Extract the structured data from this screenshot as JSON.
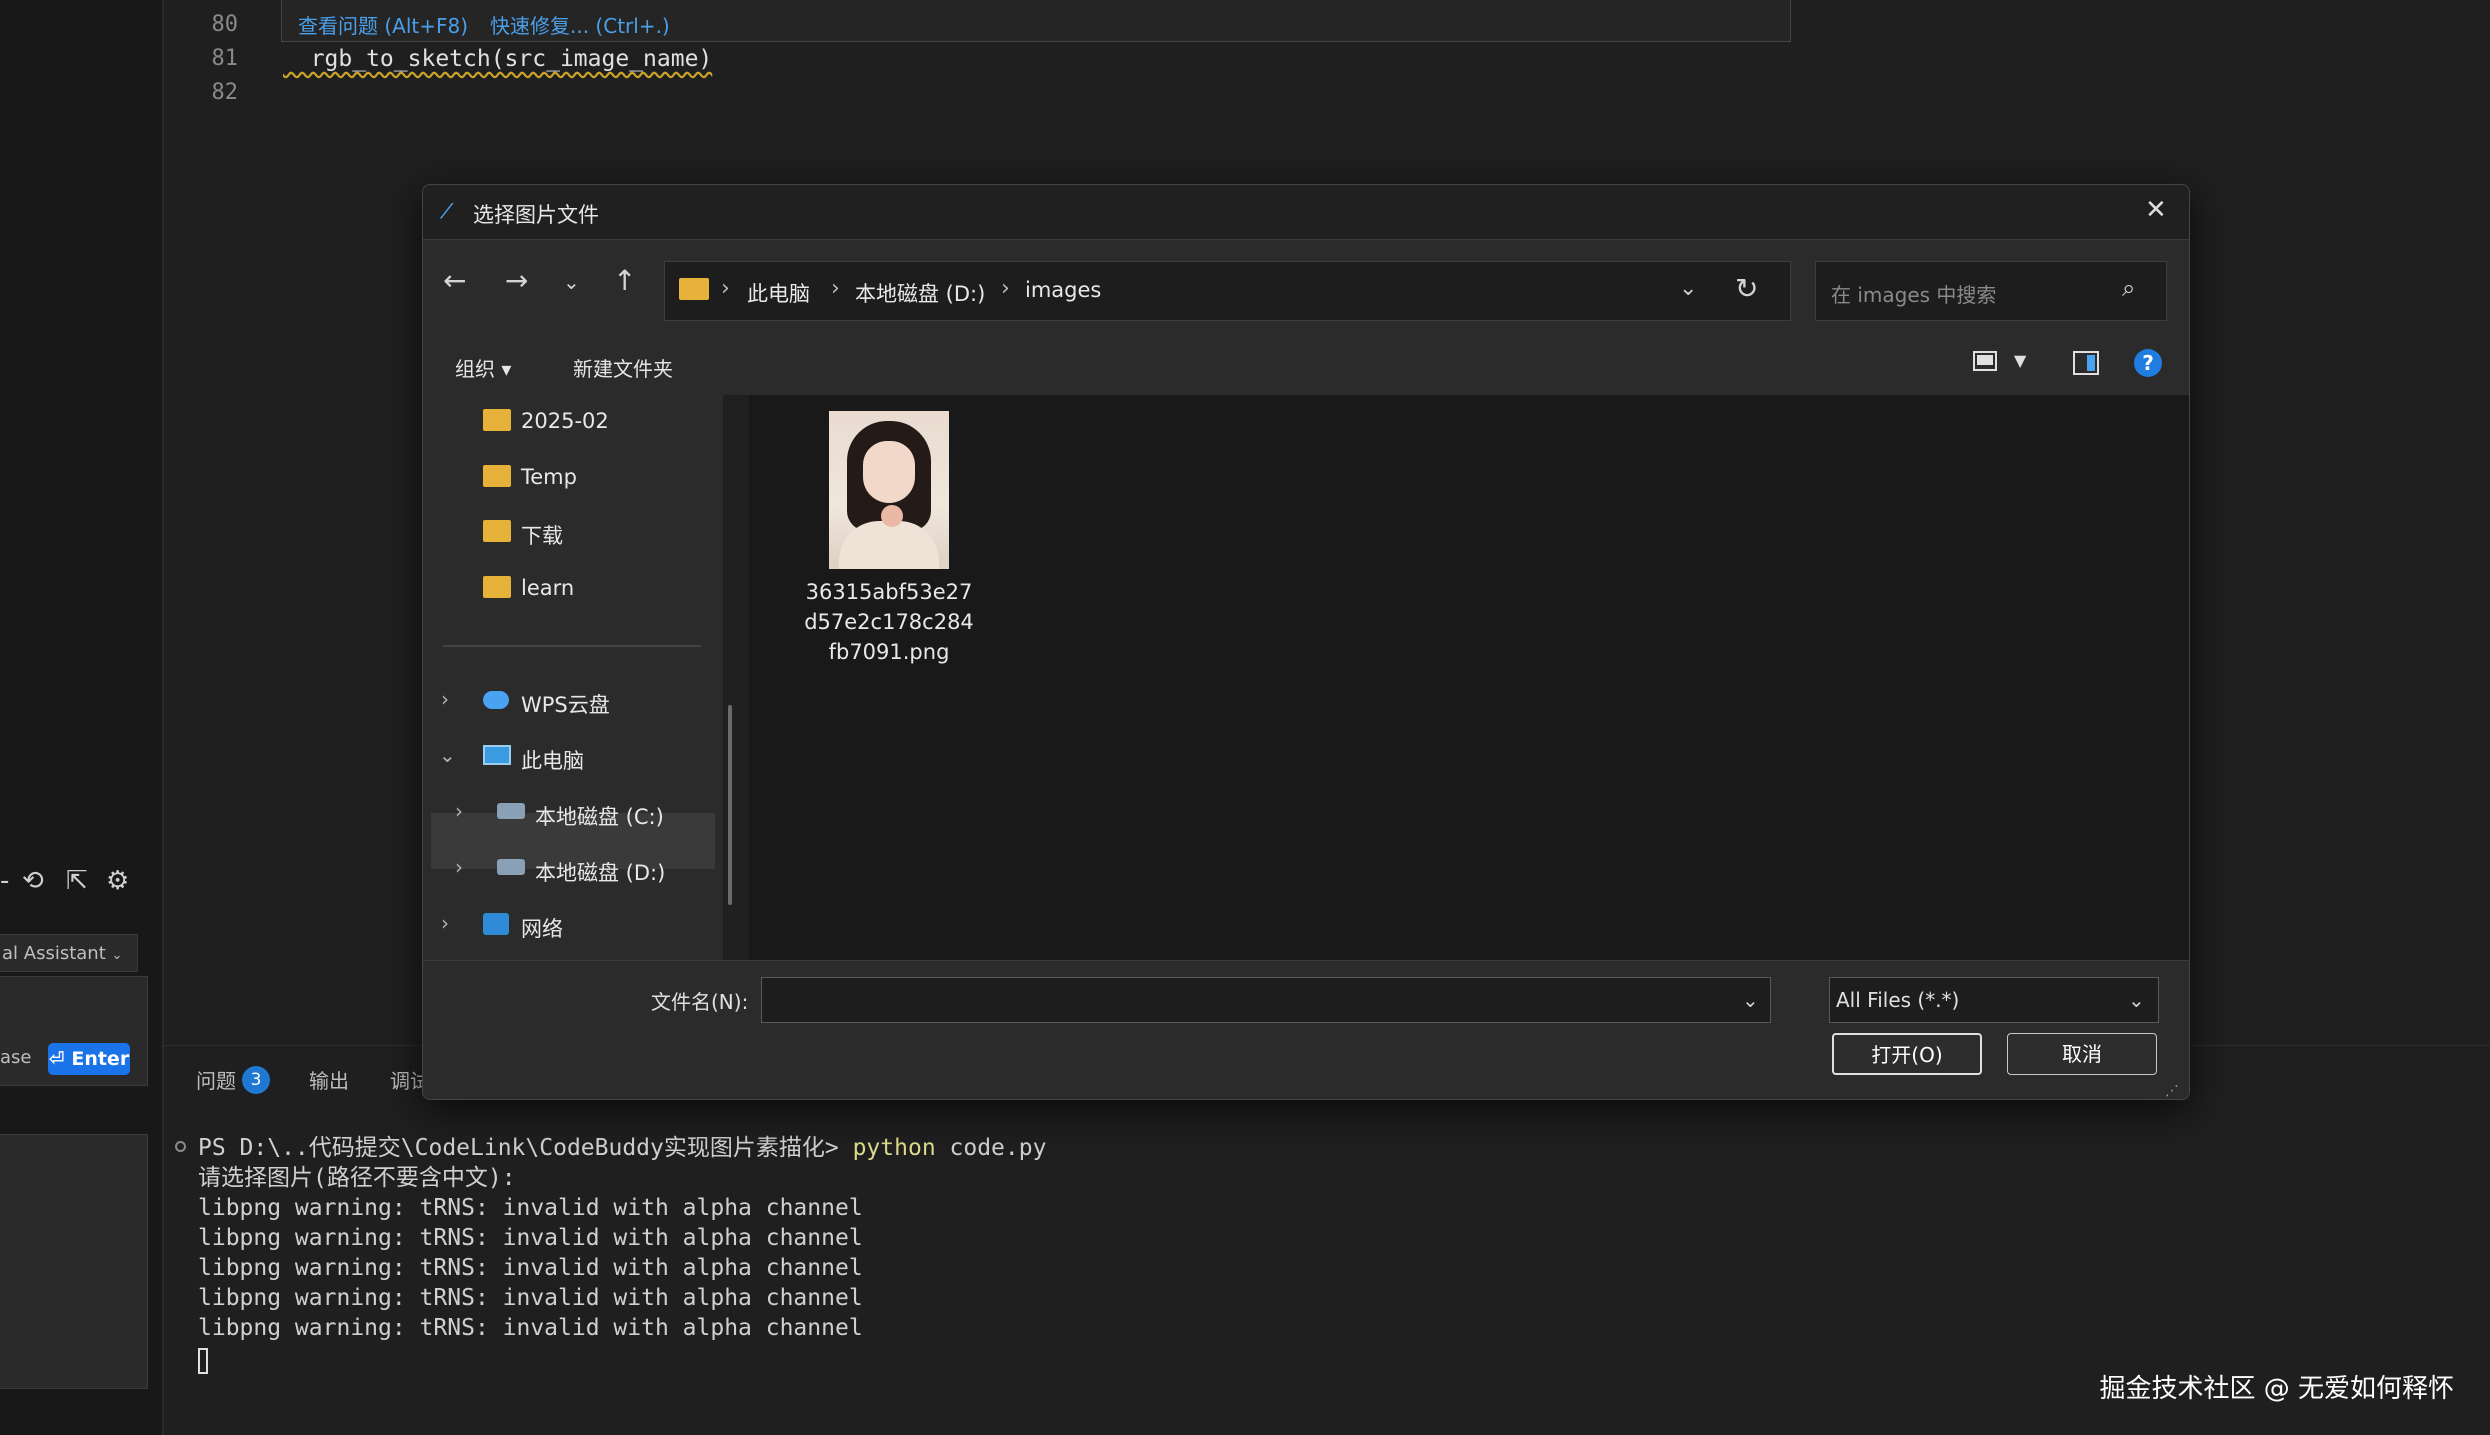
{
  "left_panel": {
    "tool_icons": [
      "minus-icon",
      "history-icon",
      "open-external-icon",
      "settings-icon"
    ],
    "assistant_select": "al Assistant",
    "chat_hint": "ase",
    "enter_button": "Enter",
    "enter_icon": "⏎"
  },
  "editor": {
    "line_numbers": [
      "80",
      "81",
      "82"
    ],
    "hover_links": [
      "查看问题 (Alt+F8)",
      "快速修复... (Ctrl+.)"
    ],
    "code_line_81": "  rgb_to_sketch(src_image_name)"
  },
  "panel": {
    "tabs": [
      "问题",
      "输出",
      "调试"
    ],
    "problems_count": "3"
  },
  "terminal": {
    "prompt": "PS D:\\..代码提交\\CodeLink\\CodeBuddy实现图片素描化> ",
    "command": "python",
    "command_args": " code.py",
    "lines": [
      "请选择图片(路径不要含中文):",
      "libpng warning: tRNS: invalid with alpha channel",
      "libpng warning: tRNS: invalid with alpha channel",
      "libpng warning: tRNS: invalid with alpha channel",
      "libpng warning: tRNS: invalid with alpha channel",
      "libpng warning: tRNS: invalid with alpha channel"
    ]
  },
  "watermark": "掘金技术社区 @ 无爱如何释怀",
  "dialog": {
    "title": "选择图片文件",
    "breadcrumb": [
      "此电脑",
      "本地磁盘 (D:)",
      "images"
    ],
    "search_placeholder": "在 images 中搜索",
    "toolbar": {
      "organize": "组织 ▾",
      "new_folder": "新建文件夹"
    },
    "nav_items": [
      {
        "label": "2025-02",
        "icon": "folder-icon"
      },
      {
        "label": "Temp",
        "icon": "folder-icon"
      },
      {
        "label": "下载",
        "icon": "folder-icon"
      },
      {
        "label": "learn",
        "icon": "folder-icon"
      },
      {
        "label": "WPS云盘",
        "icon": "cloud-icon"
      },
      {
        "label": "此电脑",
        "icon": "computer-icon"
      },
      {
        "label": "本地磁盘 (C:)",
        "icon": "disk-icon"
      },
      {
        "label": "本地磁盘 (D:)",
        "icon": "disk-icon"
      },
      {
        "label": "网络",
        "icon": "network-icon"
      }
    ],
    "files": [
      {
        "name": "36315abf53e27d57e2c178c284fb7091.png",
        "name_lines": [
          "36315abf53e27",
          "d57e2c178c284",
          "fb7091.png"
        ]
      }
    ],
    "filename_label": "文件名(N):",
    "filename_value": "",
    "filetype_value": "All Files (*.*)",
    "open_button": "打开(O)",
    "cancel_button": "取消"
  }
}
